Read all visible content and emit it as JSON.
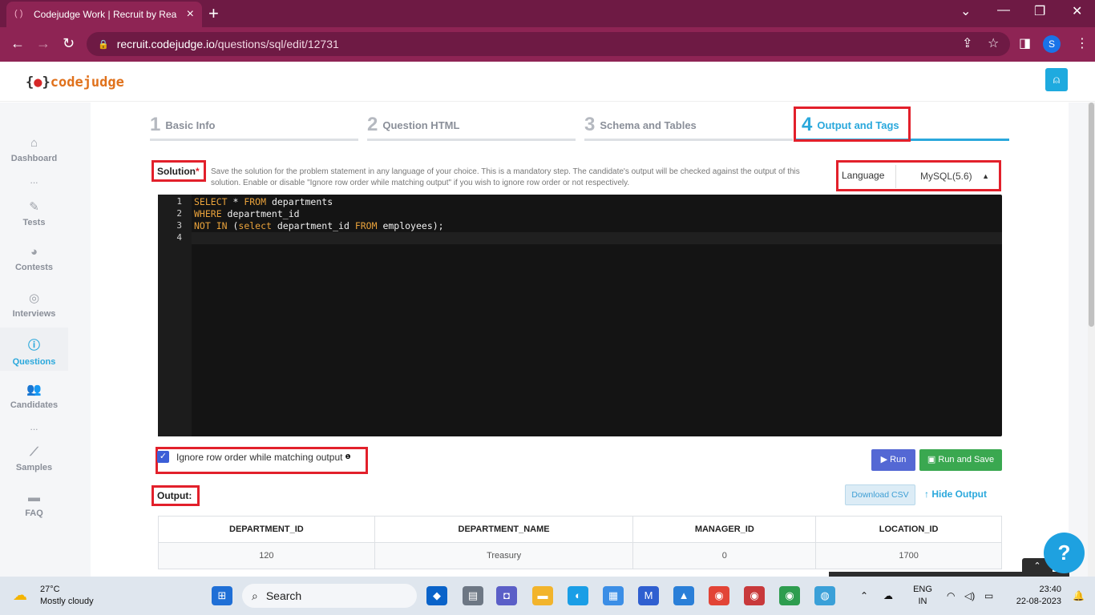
{
  "browser": {
    "tab_title": "Codejudge Work | Recruit by Rea",
    "new_tab": "+",
    "url_host": "recruit.codejudge.io",
    "url_path": "/questions/sql/edit/12731",
    "profile_initial": "S"
  },
  "app": {
    "logo_open": "{",
    "logo_close": "}",
    "logo_text": "codejudge"
  },
  "sidebar": {
    "items": [
      {
        "label": "Dashboard",
        "icon": "home-icon"
      },
      {
        "label": "Tests",
        "icon": "pencil-icon"
      },
      {
        "label": "Contests",
        "icon": "pie-icon"
      },
      {
        "label": "Interviews",
        "icon": "broadcast-icon"
      },
      {
        "label": "Questions",
        "icon": "question-icon"
      },
      {
        "label": "Candidates",
        "icon": "users-icon"
      },
      {
        "label": "Samples",
        "icon": "chart-icon"
      },
      {
        "label": "FAQ",
        "icon": "chat-icon"
      }
    ],
    "dots": "..."
  },
  "steps": [
    {
      "num": "1",
      "label": "Basic Info"
    },
    {
      "num": "2",
      "label": "Question HTML"
    },
    {
      "num": "3",
      "label": "Schema and Tables"
    },
    {
      "num": "4",
      "label": "Output and Tags"
    }
  ],
  "solution": {
    "label": "Solution",
    "required_mark": "*",
    "description": "Save the solution for the problem statement in any language of your choice. This is a mandatory step. The candidate's output will be checked against the output of this solution. Enable or disable \"Ignore row order while matching output\" if you wish to ignore row order or not respectively.",
    "language_label": "Language",
    "language_value": "MySQL(5.6)"
  },
  "editor": {
    "line_numbers": [
      "1",
      "2",
      "3",
      "4"
    ]
  },
  "options": {
    "ignore_row_order_label": "Ignore row order while matching output",
    "ignore_row_order_checked": true,
    "run_label": "Run",
    "run_save_label": "Run and Save"
  },
  "output": {
    "label": "Output:",
    "download_csv": "Download CSV",
    "hide_output": "Hide Output",
    "columns": [
      "DEPARTMENT_ID",
      "DEPARTMENT_NAME",
      "MANAGER_ID",
      "LOCATION_ID"
    ],
    "rows": [
      [
        "120",
        "Treasury",
        "0",
        "1700"
      ]
    ]
  },
  "help_label": "?",
  "taskbar": {
    "temp": "27°C",
    "weather": "Mostly cloudy",
    "search": "Search",
    "lang_line1": "ENG",
    "lang_line2": "IN",
    "time": "23:40",
    "date": "22-08-2023"
  }
}
